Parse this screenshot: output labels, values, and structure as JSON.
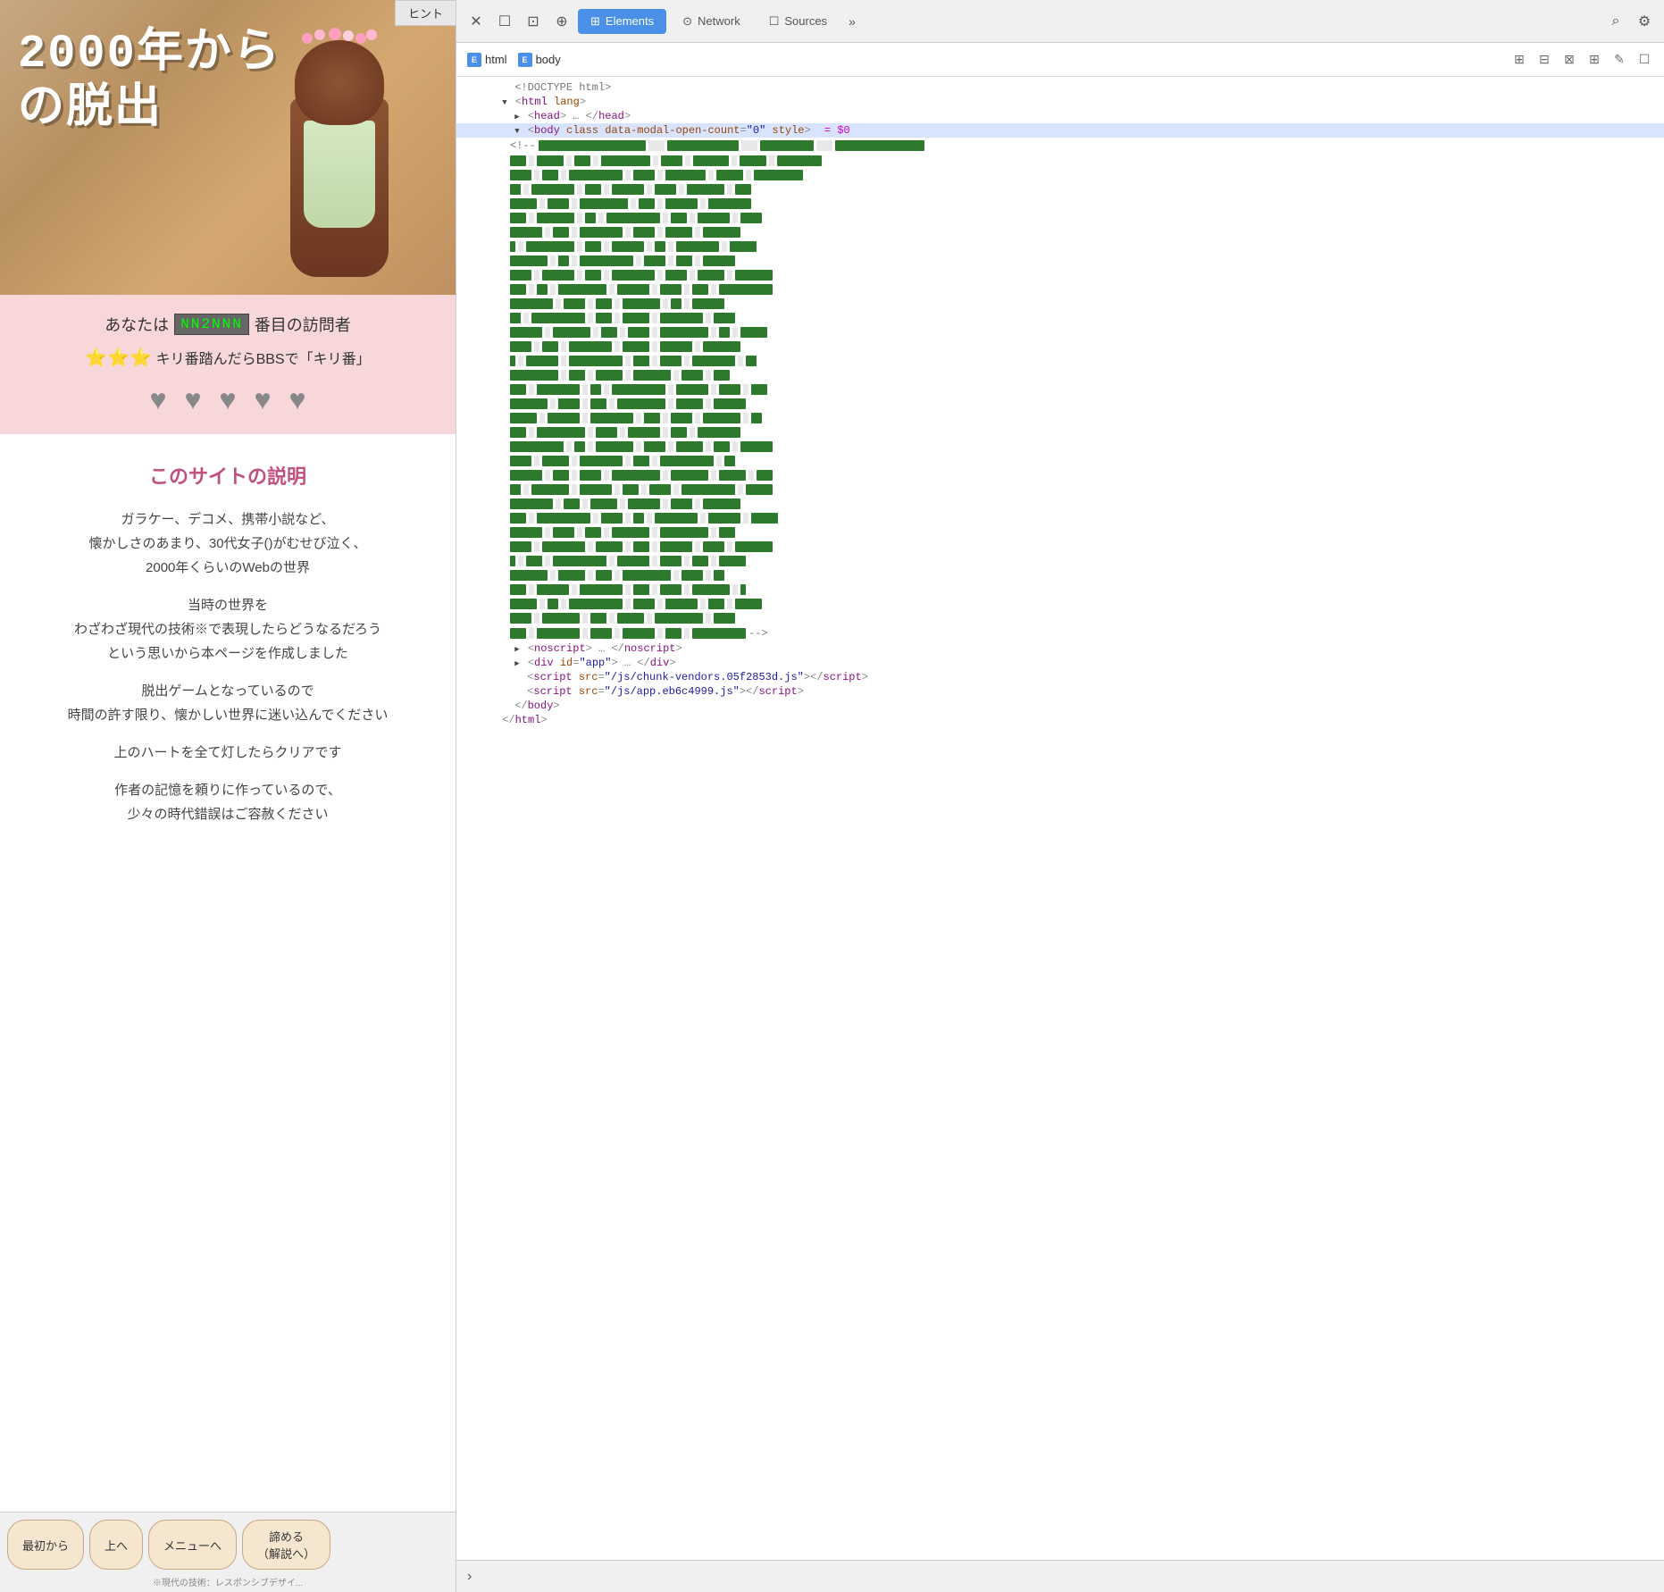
{
  "hint_tab": "ヒント",
  "hero": {
    "title_line1": "2000年から",
    "title_line2": "の脱出"
  },
  "visitor": {
    "prefix": "あなたは",
    "counter": "NN2NNN",
    "suffix": "番目の訪問者",
    "kiri_line": "キリ番踏んだらBBSで「キリ番」",
    "stars": "⭐⭐⭐"
  },
  "hearts": [
    "♥",
    "♥",
    "♥",
    "♥",
    "♥"
  ],
  "site_description": {
    "title": "このサイトの説明",
    "paragraphs": [
      "ガラケー、デコメ、携帯小説など、",
      "懐かしさのあまり、30代女子()がむせび泣く、",
      "2000年くらいのWebの世界",
      "当時の世界を",
      "わざわざ現代の技術※で表現したらどうなるだろう",
      "という思いから本ページを作成しました",
      "脱出ゲームとなっているので",
      "時間の許す限り、懐かしい世界に迷い込んでください",
      "上のハートを全て灯したらクリアです",
      "作者の記憶を頼りに作っているので、",
      "少々の時代錯誤はご容赦ください"
    ]
  },
  "bottom_nav": {
    "buttons": [
      "最初から",
      "上へ",
      "メニューへ",
      "諦める\n（解説へ）"
    ]
  },
  "bottom_note": "※現代の技術：レスポンシブデザイ...",
  "devtools": {
    "toolbar_icons": [
      "✕",
      "☐",
      "⊡",
      "⊕"
    ],
    "tabs": [
      {
        "label": "Elements",
        "icon": "⊞",
        "active": true
      },
      {
        "label": "Network",
        "icon": "⊙",
        "active": false
      },
      {
        "label": "Sources",
        "icon": "☐",
        "active": false
      }
    ],
    "more_icon": "»",
    "search_icon": "⌕",
    "settings_icon": "⚙",
    "breadcrumb": {
      "html_tag": "html",
      "body_tag": "body",
      "right_icons": [
        "⊞",
        "⊟",
        "⊠",
        "⊞",
        "✎",
        "☐"
      ]
    },
    "code": {
      "doctype": "<!DOCTYPE html>",
      "html_open": "<html lang>",
      "head": "<head>…</head>",
      "body_open": "<body class data-modal-open-count=\"0\" style>",
      "body_var": "$0",
      "noscript": "<noscript>…</noscript>",
      "div_app": "<div id=\"app\">…</div>",
      "script1": "<script src=\"/js/chunk-vendors.05f2853d.js\"></script>",
      "script2": "<script src=\"/js/app.eb6c4999.js\"></script>",
      "body_close": "</body>",
      "html_close": "</html>"
    }
  }
}
